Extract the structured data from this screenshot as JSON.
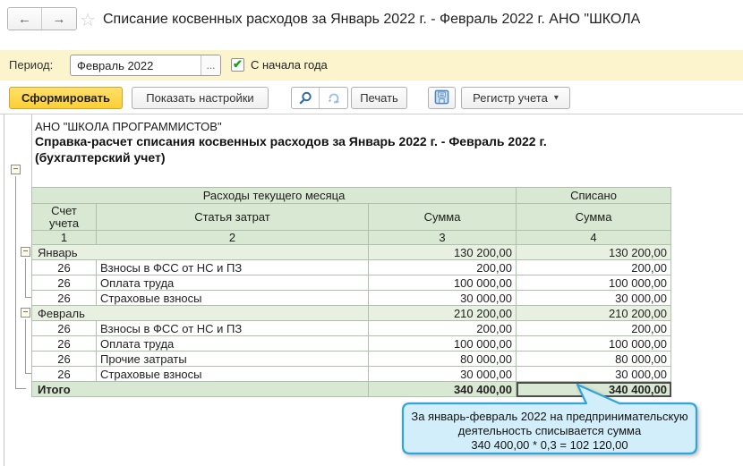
{
  "window": {
    "title": "Списание косвенных расходов за Январь 2022 г. - Февраль 2022 г. АНО \"ШКОЛА"
  },
  "icons": {
    "back": "←",
    "forward": "→",
    "star": "☆",
    "check": "✔",
    "dropdown": "▾",
    "ellipsis": "...",
    "collapse": "−"
  },
  "period_bar": {
    "label": "Период:",
    "value": "Февраль 2022",
    "checkbox_label": "С начала года",
    "checkbox_checked": true
  },
  "toolbar": {
    "generate": "Сформировать",
    "settings": "Показать настройки",
    "print": "Печать",
    "register": "Регистр учета"
  },
  "report": {
    "org": "АНО \"ШКОЛА ПРОГРАММИСТОВ\"",
    "title": "Справка-расчет списания косвенных расходов за Январь 2022 г. - Февраль 2022 г.",
    "subtitle": "(бухгалтерский учет)",
    "table": {
      "group_headers": [
        "Расходы текущего месяца",
        "Списано"
      ],
      "col_headers": [
        "Счет учета",
        "Статья затрат",
        "Сумма",
        "Сумма"
      ],
      "col_numbers": [
        "1",
        "2",
        "3",
        "4"
      ],
      "rows": [
        {
          "type": "group",
          "label": "Январь",
          "current": "130 200,00",
          "written": "130 200,00"
        },
        {
          "type": "detail",
          "account": "26",
          "item": "Взносы в ФСС от НС и ПЗ",
          "current": "200,00",
          "written": "200,00"
        },
        {
          "type": "detail",
          "account": "26",
          "item": "Оплата труда",
          "current": "100 000,00",
          "written": "100 000,00"
        },
        {
          "type": "detail",
          "account": "26",
          "item": "Страховые взносы",
          "current": "30 000,00",
          "written": "30 000,00"
        },
        {
          "type": "group",
          "label": "Февраль",
          "current": "210 200,00",
          "written": "210 200,00"
        },
        {
          "type": "detail",
          "account": "26",
          "item": "Взносы в ФСС от НС и ПЗ",
          "current": "200,00",
          "written": "200,00"
        },
        {
          "type": "detail",
          "account": "26",
          "item": "Оплата труда",
          "current": "100 000,00",
          "written": "100 000,00"
        },
        {
          "type": "detail",
          "account": "26",
          "item": "Прочие затраты",
          "current": "80 000,00",
          "written": "80 000,00"
        },
        {
          "type": "detail",
          "account": "26",
          "item": "Страховые взносы",
          "current": "30 000,00",
          "written": "30 000,00"
        },
        {
          "type": "total",
          "label": "Итого",
          "current": "340 400,00",
          "written": "340 400,00",
          "selected": true
        }
      ]
    },
    "callout": {
      "lines": [
        "За январь-февраль 2022 на предпринимательскую",
        "деятельность списывается сумма",
        "340 400,00 * 0,3 = 102 120,00"
      ]
    }
  },
  "colors": {
    "period_bar_bg": "#fbf4cd",
    "generate_button": "#fcd23b",
    "table_header_bg": "#d9e8d2",
    "group_row_bg": "#e8f1e1",
    "callout_fill": "#d3eefb",
    "callout_border": "#2fa5d9",
    "icon_blue": "#3c79b4"
  }
}
